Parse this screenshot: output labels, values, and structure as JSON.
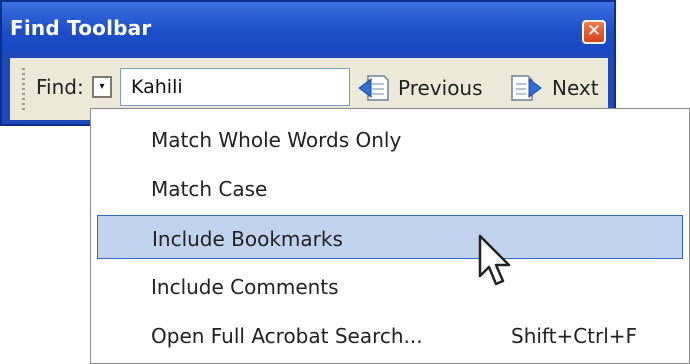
{
  "window": {
    "title": "Find Toolbar",
    "close_label": "✕"
  },
  "toolbar": {
    "find_label": "Find:",
    "options_arrow": "▾",
    "search_value": "Kahili",
    "previous_label": "Previous",
    "next_label": "Next"
  },
  "menu": {
    "items": [
      {
        "label": "Match Whole Words Only",
        "shortcut": ""
      },
      {
        "label": "Match Case",
        "shortcut": ""
      },
      {
        "label": "Include Bookmarks",
        "shortcut": "",
        "highlighted": true
      },
      {
        "label": "Include Comments",
        "shortcut": ""
      },
      {
        "label": "Open Full Acrobat Search...",
        "shortcut": "Shift+Ctrl+F"
      }
    ]
  },
  "colors": {
    "title_bar": "#1d4fc9",
    "close_button": "#e05a2d",
    "toolbar_bg": "#ece9d8",
    "menu_highlight": "#c1d2ee",
    "menu_highlight_border": "#316ac5"
  },
  "icons": [
    "close-icon",
    "dropdown-arrow-icon",
    "previous-document-icon",
    "next-document-icon",
    "mouse-pointer-icon"
  ]
}
